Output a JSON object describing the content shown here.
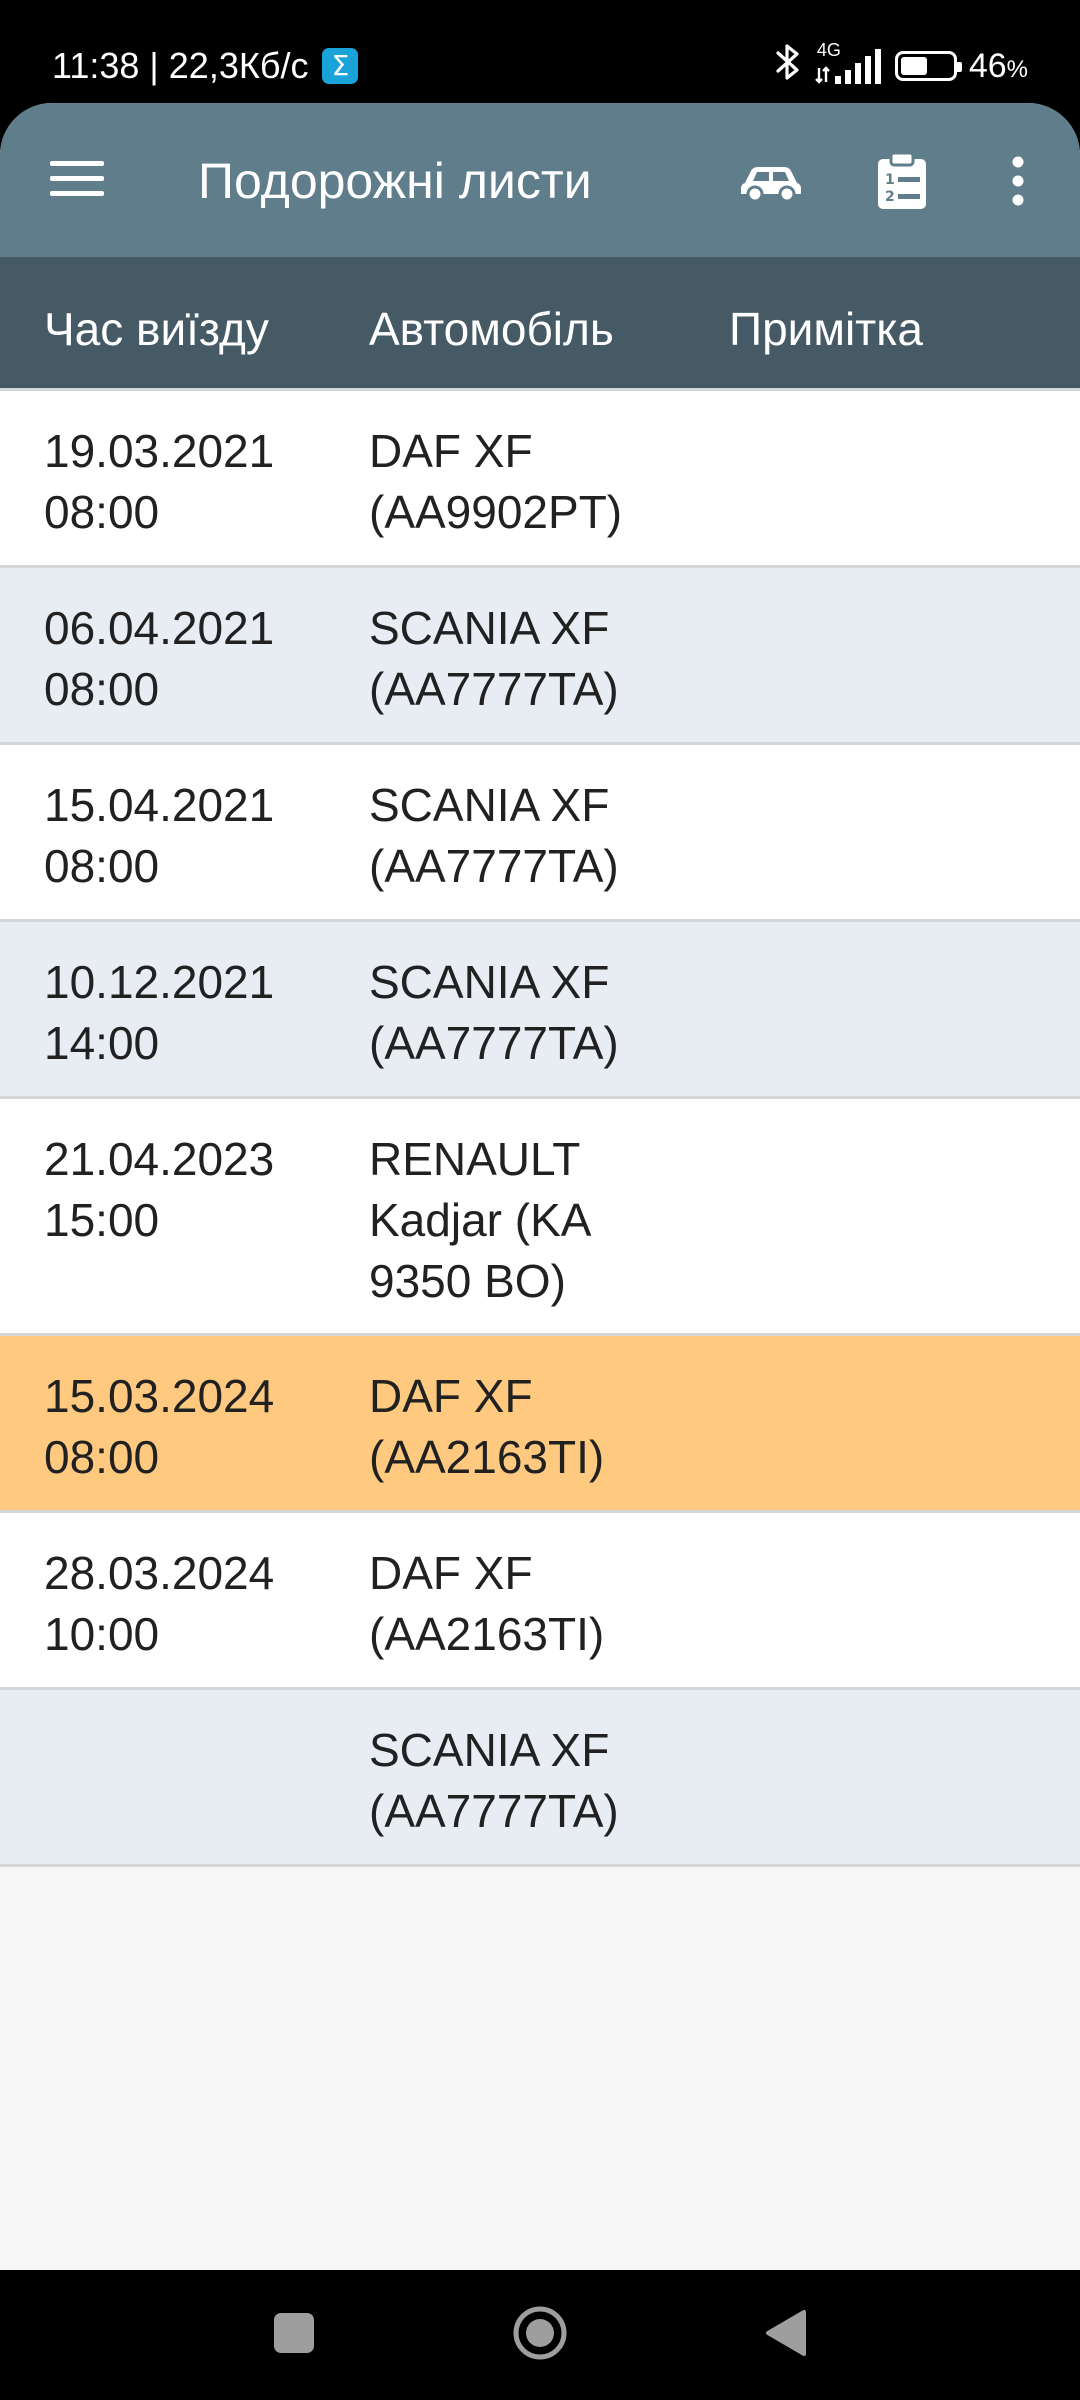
{
  "status_bar": {
    "time": "11:38",
    "speed": "22,3Кб/с",
    "network_type": "4G",
    "battery_percent": "46",
    "battery_unit": "%",
    "battery_level": 0.46,
    "badge_glyph": "Σ"
  },
  "toolbar": {
    "title": "Подорожні листи",
    "menu_icon": "menu-icon",
    "car_icon": "car-icon",
    "clipboard_icon": "clipboard-list-icon",
    "more_icon": "more-vert-icon"
  },
  "columns": {
    "time": "Час виїзду",
    "car": "Автомобіль",
    "note": "Примітка"
  },
  "rows": [
    {
      "date": "19.03.2021",
      "time": "08:00",
      "car": [
        "DAF XF",
        "(AA9902PT)"
      ],
      "note": ""
    },
    {
      "date": "06.04.2021",
      "time": "08:00",
      "car": [
        "SCANIA XF",
        "(AA7777TA)"
      ],
      "note": ""
    },
    {
      "date": "15.04.2021",
      "time": "08:00",
      "car": [
        "SCANIA XF",
        "(AA7777TA)"
      ],
      "note": ""
    },
    {
      "date": "10.12.2021",
      "time": "14:00",
      "car": [
        "SCANIA XF",
        "(AA7777TA)"
      ],
      "note": ""
    },
    {
      "date": "21.04.2023",
      "time": "15:00",
      "car": [
        "RENAULT",
        "Kadjar (KA",
        "9350 BO)"
      ],
      "note": ""
    },
    {
      "date": "15.03.2024",
      "time": "08:00",
      "car": [
        "DAF XF",
        "(AA2163TI)"
      ],
      "note": "",
      "selected": true
    },
    {
      "date": "28.03.2024",
      "time": "10:00",
      "car": [
        "DAF XF",
        "(AA2163TI)"
      ],
      "note": ""
    },
    {
      "date": "",
      "time": "",
      "car": [
        "SCANIA XF",
        "(AA7777TA)"
      ],
      "note": ""
    }
  ],
  "colors": {
    "toolbar": "#607d8b",
    "header": "#455a64",
    "row_alt": "#e8edf3",
    "row_selected": "#ffca80"
  },
  "nav_bar": {
    "recent_icon": "recent-apps-icon",
    "home_icon": "home-icon",
    "back_icon": "back-icon"
  }
}
